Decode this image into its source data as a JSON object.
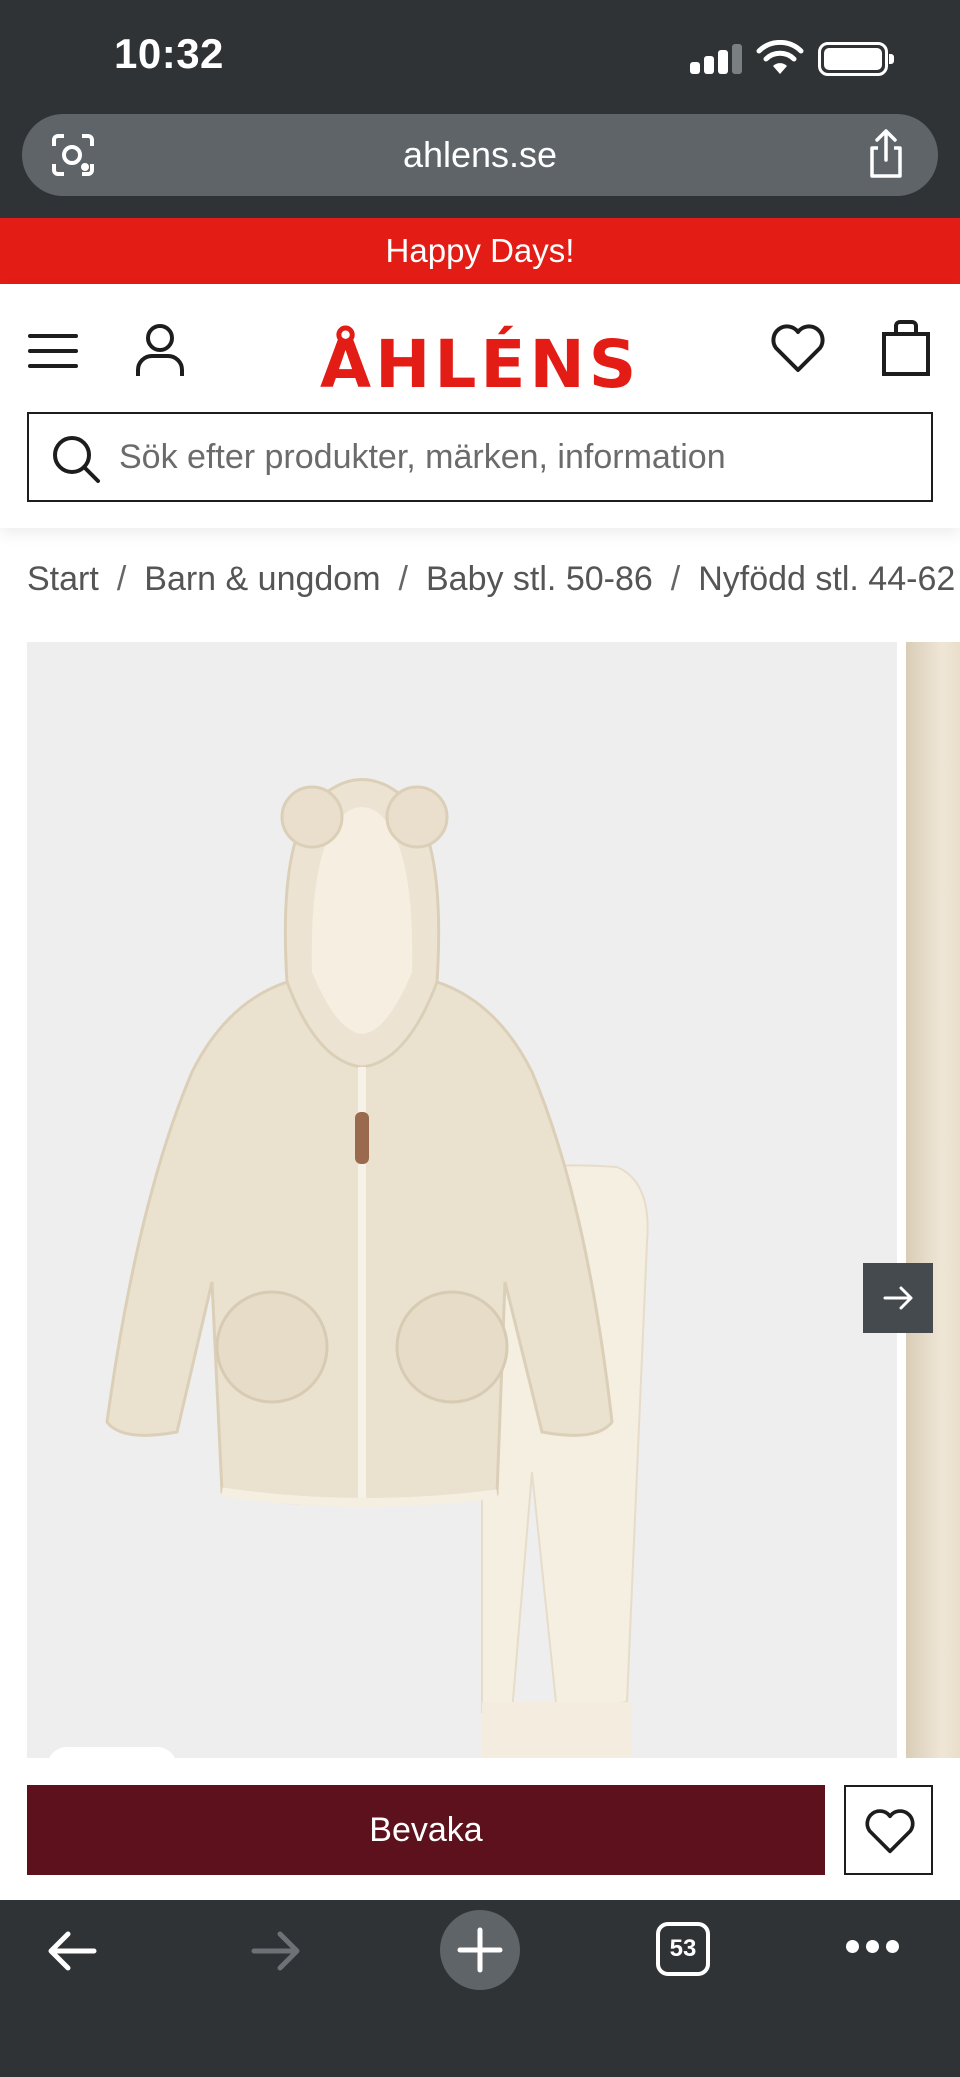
{
  "status_bar": {
    "time": "10:32",
    "icons": [
      "signal-icon",
      "wifi-icon",
      "battery-icon"
    ]
  },
  "browser": {
    "url": "ahlens.se",
    "icons": [
      "lens-icon",
      "share-icon"
    ]
  },
  "promo": {
    "text": "Happy Days!",
    "background": "#e31c15"
  },
  "header": {
    "logo": "ÅHLÉNS",
    "icons": [
      "menu-icon",
      "user-icon",
      "heart-icon",
      "bag-icon"
    ],
    "brand_color": "#e31c15"
  },
  "search": {
    "placeholder": "Sök efter produkter, märken, information"
  },
  "breadcrumb": {
    "items": [
      "Start",
      "Barn & ungdom",
      "Baby stl. 50-86",
      "Nyfödd stl. 44-62"
    ],
    "separator": "/"
  },
  "gallery": {
    "icons": [
      "arrow-right-icon"
    ]
  },
  "actions": {
    "watch_label": "Bevaka",
    "watch_color": "#5c111c",
    "favorite_icon": "heart-icon"
  },
  "toolbar": {
    "tab_count": "53",
    "icons": [
      "back-icon",
      "forward-icon",
      "new-tab-icon",
      "tabs-icon",
      "more-icon"
    ]
  }
}
